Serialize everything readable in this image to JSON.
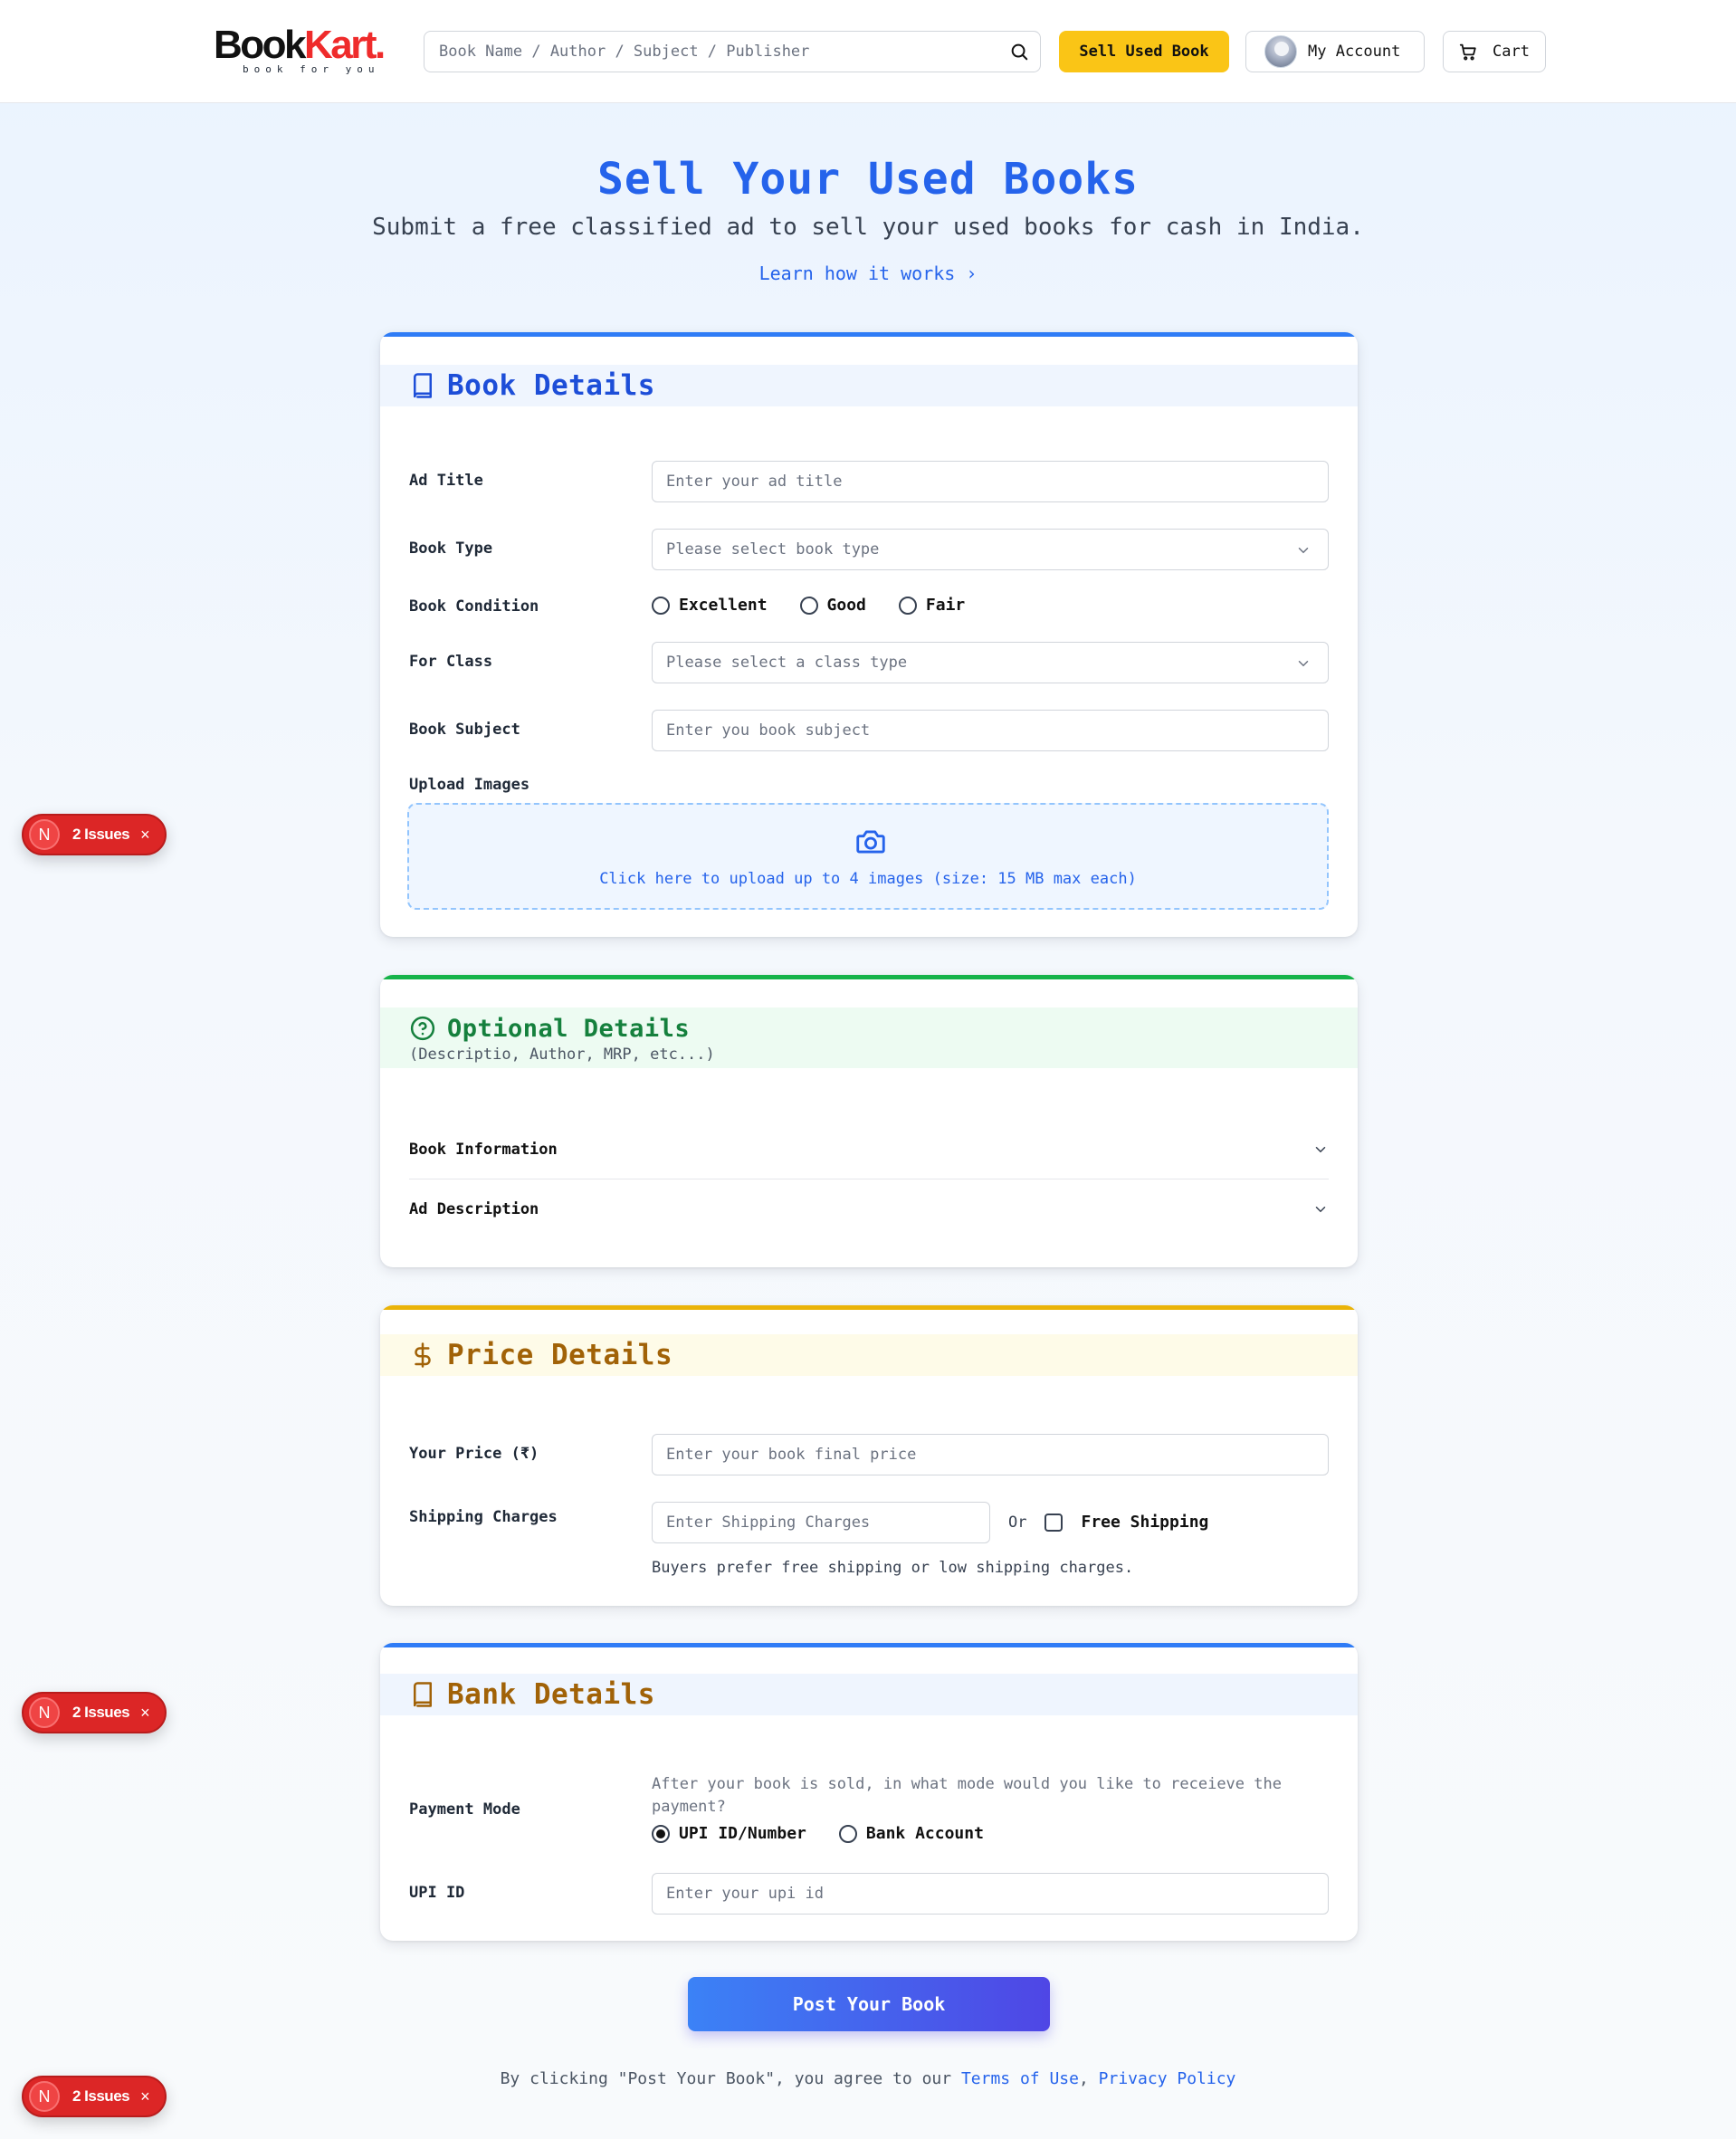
{
  "header": {
    "logo_book": "Book",
    "logo_kart": "Kart.",
    "logo_tagline": "book for you",
    "search_placeholder": "Book Name / Author / Subject / Publisher",
    "sell_label": "Sell Used Book",
    "account_label": "My Account",
    "cart_label": "Cart"
  },
  "hero": {
    "title": "Sell Your Used Books",
    "subtitle": "Submit a free classified ad to sell your used books for cash in India.",
    "link": "Learn how it works ›"
  },
  "book_details": {
    "title": "Book Details",
    "ad_title_label": "Ad Title",
    "ad_title_placeholder": "Enter your ad title",
    "book_type_label": "Book Type",
    "book_type_value": "Please select book type",
    "condition_label": "Book Condition",
    "condition_options": [
      "Excellent",
      "Good",
      "Fair"
    ],
    "class_label": "For Class",
    "class_value": "Please select a class type",
    "subject_label": "Book Subject",
    "subject_placeholder": "Enter you book subject",
    "upload_label": "Upload Images",
    "upload_text": "Click here to upload up to 4 images (size: 15 MB max each)"
  },
  "optional_details": {
    "title": "Optional Details",
    "subtitle": "(Descriptio, Author, MRP, etc...)",
    "sections": [
      "Book Information",
      "Ad Description"
    ]
  },
  "price_details": {
    "title": "Price Details",
    "price_label": "Your Price (₹)",
    "price_placeholder": "Enter your book final price",
    "shipping_label": "Shipping Charges",
    "shipping_placeholder": "Enter Shipping Charges",
    "or_label": "Or",
    "free_shipping_label": "Free Shipping",
    "note": "Buyers prefer free shipping or low shipping charges."
  },
  "bank_details": {
    "title": "Bank Details",
    "payment_label": "Payment Mode",
    "payment_question": "After your book is sold, in what mode would you like to receieve the payment?",
    "payment_options": [
      "UPI ID/Number",
      "Bank Account"
    ],
    "payment_selected": "UPI ID/Number",
    "upi_label": "UPI ID",
    "upi_placeholder": "Enter your upi id"
  },
  "footer": {
    "post_button": "Post Your Book",
    "terms_prefix": "By clicking \"Post Your Book\", you agree to our",
    "terms_link": "Terms of Use",
    "terms_sep": ",",
    "privacy_link": "Privacy Policy"
  },
  "issues_badge": {
    "letter": "N",
    "text": "2 Issues",
    "close": "×"
  },
  "colors": {
    "primary": "#2563eb",
    "sell_button": "#fac516",
    "logo_accent": "#ef2b2b",
    "optional_accent": "#16a34a",
    "price_accent": "#eab308",
    "issues_badge": "#dc2626"
  }
}
